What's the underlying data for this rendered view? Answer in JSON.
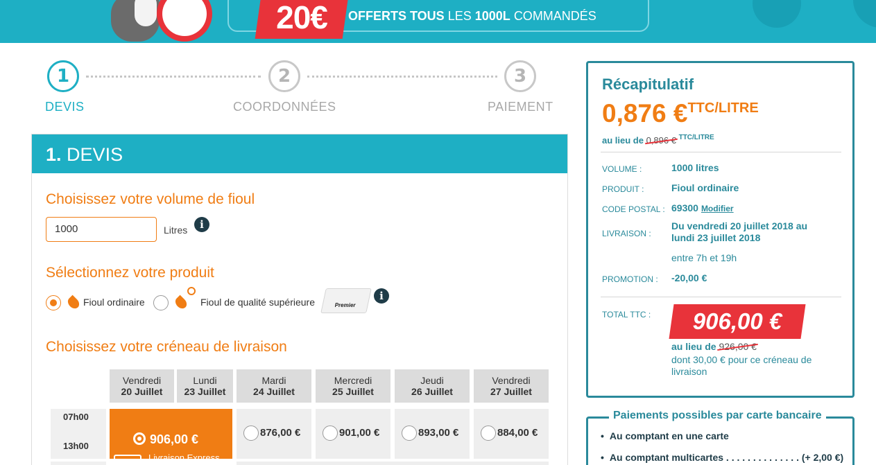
{
  "banner": {
    "promo_amount": "20€",
    "promo_text_1": "OFFERTS TOUS",
    "promo_text_2": "LES",
    "promo_text_3": "1000L",
    "promo_text_4": "COMMANDÉS"
  },
  "steps": [
    {
      "number": "1",
      "label": "DEVIS",
      "active": true
    },
    {
      "number": "2",
      "label": "COORDONNÉES",
      "active": false
    },
    {
      "number": "3",
      "label": "PAIEMENT",
      "active": false
    }
  ],
  "devis": {
    "header_number": "1.",
    "header_title": "DEVIS",
    "volume_title": "Choisissez votre volume de fioul",
    "volume_value": "1000",
    "volume_unit": "Litres",
    "product_title": "Sélectionnez votre produit",
    "products": [
      {
        "label": "Fioul ordinaire",
        "selected": true
      },
      {
        "label": "Fioul de qualité supérieure",
        "selected": false,
        "badge": "Premier"
      }
    ],
    "slot_title": "Choisissez votre créneau de livraison",
    "days": [
      {
        "day": "Vendredi",
        "date": "20 Juillet"
      },
      {
        "day": "Lundi",
        "date": "23 Juillet"
      },
      {
        "day": "Mardi",
        "date": "24 Juillet"
      },
      {
        "day": "Mercredi",
        "date": "25 Juillet"
      },
      {
        "day": "Jeudi",
        "date": "26 Juillet"
      },
      {
        "day": "Vendredi",
        "date": "27 Juillet"
      }
    ],
    "time_from": "07h00",
    "time_to": "13h00",
    "slots": [
      {
        "price": "906,00 €",
        "selected": true,
        "note": "Livraison Express"
      },
      {
        "price": "876,00 €",
        "selected": false
      },
      {
        "price": "901,00 €",
        "selected": false
      },
      {
        "price": "893,00 €",
        "selected": false
      },
      {
        "price": "884,00 €",
        "selected": false
      }
    ]
  },
  "recap": {
    "title": "Récapitulatif",
    "price": "0,876 €",
    "price_unit": "TTC/LITRE",
    "was_prefix": "au lieu de",
    "was_price": "0,896 €",
    "was_unit": "TTC/LITRE",
    "rows": [
      {
        "key": "VOLUME :",
        "value": "1000 litres"
      },
      {
        "key": "PRODUIT :",
        "value": "Fioul ordinaire"
      },
      {
        "key": "CODE POSTAL :",
        "value": "69300",
        "link": "Modifier"
      },
      {
        "key": "LIVRAISON :",
        "value": "Du vendredi 20 juillet 2018 au lundi 23 juillet 2018",
        "extra": "entre 7h et 19h"
      },
      {
        "key": "PROMOTION :",
        "value": "-20,00 €"
      }
    ],
    "total_key": "TOTAL TTC :",
    "total_value": "906,00 €",
    "total_was_prefix": "au lieu de",
    "total_was": "926,00 €",
    "total_note": "dont 30,00 € pour ce créneau de livraison"
  },
  "payments": {
    "title": "Paiements possibles par carte bancaire",
    "items": [
      "Au comptant en une carte",
      "Au comptant multicartes . . . . . . . . . . . . . . (+ 2,00 €)"
    ]
  },
  "colors": {
    "teal": "#1eafc4",
    "dark_teal": "#2a8a9b",
    "orange": "#f07d14",
    "red": "#e8333a"
  }
}
